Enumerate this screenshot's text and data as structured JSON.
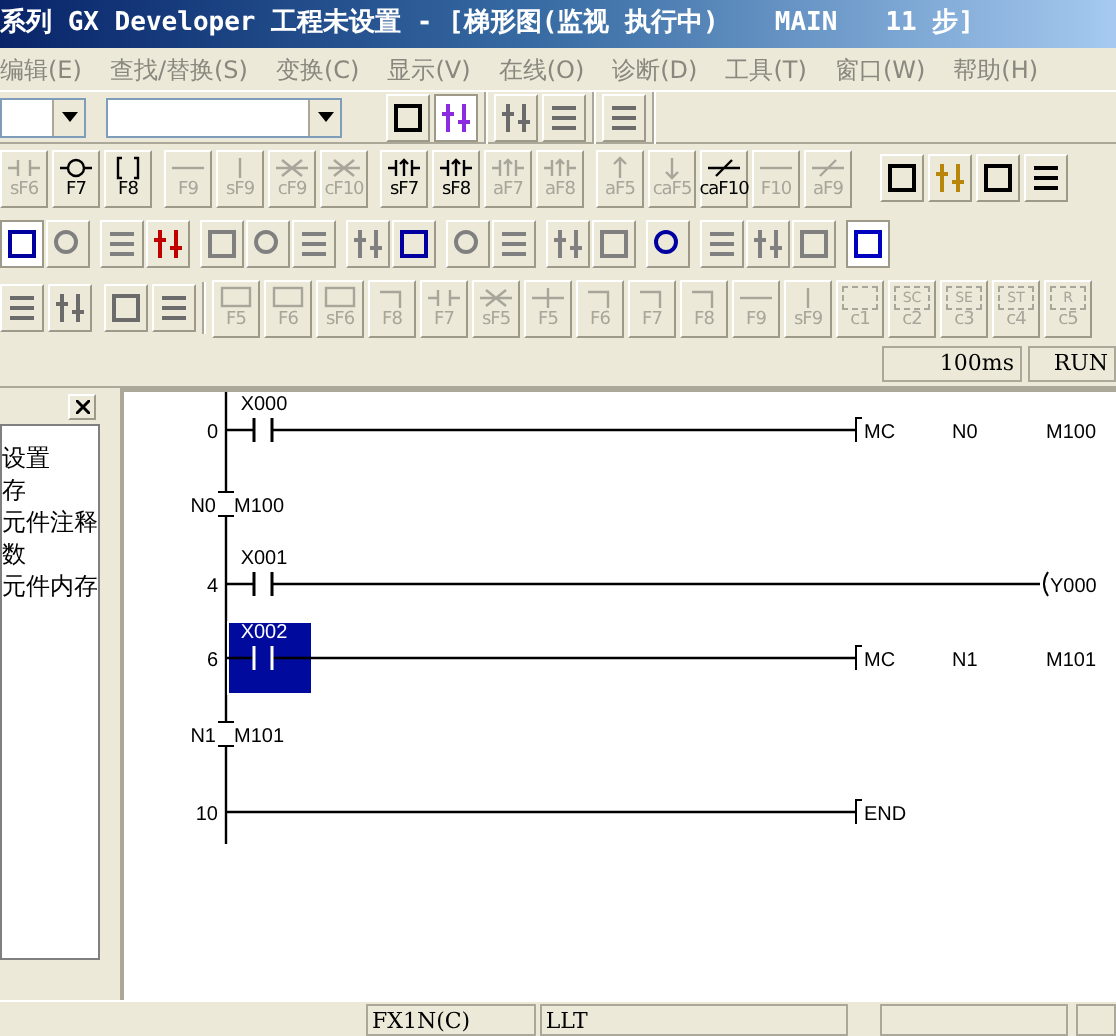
{
  "window": {
    "title": "系列 GX Developer 工程未设置 - [梯形图(监视 执行中)",
    "program": "MAIN",
    "steps": "11 步]"
  },
  "menu": [
    "编辑(E)",
    "查找/替换(S)",
    "变换(C)",
    "显示(V)",
    "在线(O)",
    "诊断(D)",
    "工具(T)",
    "窗口(W)",
    "帮助(H)"
  ],
  "fkey_toolbar": [
    {
      "buttons": [
        {
          "label": "sF6",
          "kind": "contact",
          "disabled": true
        },
        {
          "label": "F7",
          "kind": "coil",
          "disabled": false
        },
        {
          "label": "F8",
          "kind": "instruction",
          "disabled": false
        }
      ]
    },
    {
      "buttons": [
        {
          "label": "F9",
          "kind": "hline",
          "disabled": true
        },
        {
          "label": "sF9",
          "kind": "vline",
          "disabled": true
        },
        {
          "label": "cF9",
          "kind": "delete",
          "disabled": true
        },
        {
          "label": "cF10",
          "kind": "delete",
          "disabled": true
        }
      ]
    },
    {
      "buttons": [
        {
          "label": "sF7",
          "kind": "pulse",
          "disabled": false
        },
        {
          "label": "sF8",
          "kind": "pulse",
          "disabled": false
        },
        {
          "label": "aF7",
          "kind": "pulse",
          "disabled": true
        },
        {
          "label": "aF8",
          "kind": "pulse",
          "disabled": true
        }
      ]
    },
    {
      "buttons": [
        {
          "label": "aF5",
          "kind": "up",
          "disabled": true
        },
        {
          "label": "caF5",
          "kind": "down",
          "disabled": true
        },
        {
          "label": "caF10",
          "kind": "invert",
          "disabled": false
        },
        {
          "label": "F10",
          "kind": "hline",
          "disabled": true
        },
        {
          "label": "aF9",
          "kind": "invert",
          "disabled": true
        }
      ]
    }
  ],
  "sfc_toolbar": [
    {
      "label": "F5",
      "kind": "box",
      "disabled": true
    },
    {
      "label": "F6",
      "kind": "box",
      "disabled": true
    },
    {
      "label": "sF6",
      "kind": "box",
      "disabled": true
    },
    {
      "label": "F8",
      "kind": "corner",
      "disabled": true
    },
    {
      "label": "F7",
      "kind": "contact",
      "disabled": true
    },
    {
      "label": "sF5",
      "kind": "delete",
      "disabled": true
    },
    {
      "label": "F5",
      "kind": "cross",
      "disabled": true
    },
    {
      "label": "F6",
      "kind": "corner",
      "disabled": true
    },
    {
      "label": "F7",
      "kind": "corner",
      "disabled": true
    },
    {
      "label": "F8",
      "kind": "corner",
      "disabled": true
    },
    {
      "label": "F9",
      "kind": "hline",
      "disabled": true
    },
    {
      "label": "sF9",
      "kind": "vline",
      "disabled": true
    },
    {
      "label": "c1",
      "kind": "dashed",
      "disabled": true
    },
    {
      "label": "c2",
      "kind": "dashed",
      "symbol": "SC",
      "disabled": true
    },
    {
      "label": "c3",
      "kind": "dashed",
      "symbol": "SE",
      "disabled": true
    },
    {
      "label": "c4",
      "kind": "dashed",
      "symbol": "ST",
      "disabled": true
    },
    {
      "label": "c5",
      "kind": "dashed",
      "symbol": "R",
      "disabled": true
    }
  ],
  "monitor_status": {
    "scan_time": "100ms",
    "cpu_state": "RUN"
  },
  "project_tree": [
    "设置",
    "存",
    "元件注释",
    "数",
    "元件内存"
  ],
  "ladder": [
    {
      "kind": "rung",
      "step": "0",
      "contact": "X000",
      "selected": false,
      "output": {
        "kind": "instruction",
        "operands": [
          "MC",
          "N0",
          "M100"
        ]
      }
    },
    {
      "kind": "mc_marker",
      "nest": "N0",
      "relay": "M100"
    },
    {
      "kind": "rung",
      "step": "4",
      "contact": "X001",
      "selected": false,
      "output": {
        "kind": "coil",
        "operands": [
          "Y000"
        ]
      }
    },
    {
      "kind": "rung",
      "step": "6",
      "contact": "X002",
      "selected": true,
      "output": {
        "kind": "instruction",
        "operands": [
          "MC",
          "N1",
          "M101"
        ]
      }
    },
    {
      "kind": "mc_marker",
      "nest": "N1",
      "relay": "M101"
    },
    {
      "kind": "end",
      "step": "10",
      "output": {
        "kind": "instruction",
        "operands": [
          "END"
        ]
      }
    }
  ],
  "status_bar": {
    "plc_type": "FX1N(C)",
    "mode": "LLT"
  }
}
